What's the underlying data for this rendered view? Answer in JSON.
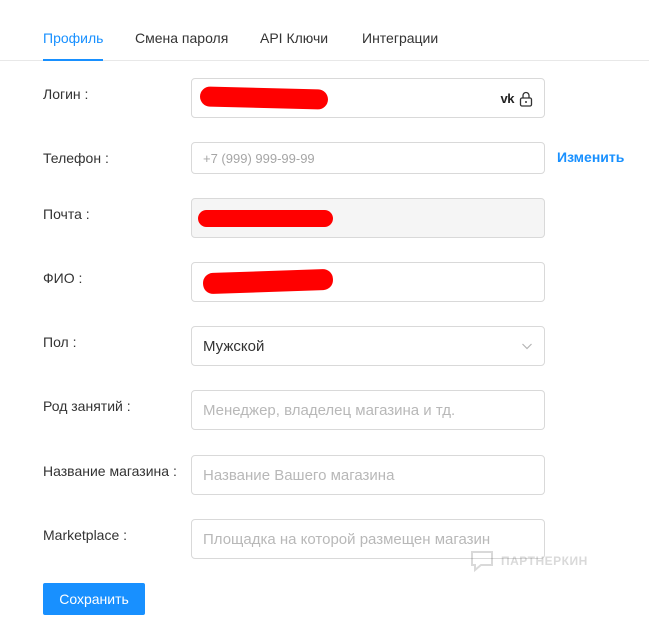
{
  "tabs": [
    {
      "label": "Профиль",
      "active": true
    },
    {
      "label": "Смена пароля",
      "active": false
    },
    {
      "label": "API Ключи",
      "active": false
    },
    {
      "label": "Интеграции",
      "active": false
    }
  ],
  "form": {
    "login": {
      "label": "Логин :",
      "auth_icon": "vk-icon",
      "vk_text": "vk",
      "lock_icon": "lock-icon"
    },
    "phone": {
      "label": "Телефон :",
      "placeholder": "+7 (999) 999-99-99",
      "change_link": "Изменить"
    },
    "email": {
      "label": "Почта :"
    },
    "fio": {
      "label": "ФИО :"
    },
    "gender": {
      "label": "Пол :",
      "value": "Мужской",
      "icon": "chevron-down-icon"
    },
    "occupation": {
      "label": "Род занятий :",
      "placeholder": "Менеджер, владелец магазина и тд."
    },
    "shop_name": {
      "label": "Название магазина :",
      "placeholder": "Название Вашего магазина"
    },
    "marketplace": {
      "label": "Marketplace :",
      "placeholder": "Площадка на которой размещен магазин"
    }
  },
  "watermark": {
    "text": "ПАРТНЕРКИН"
  },
  "save_button": {
    "label": "Сохранить"
  },
  "colors": {
    "accent": "#1890ff",
    "redaction": "#ff0000"
  }
}
